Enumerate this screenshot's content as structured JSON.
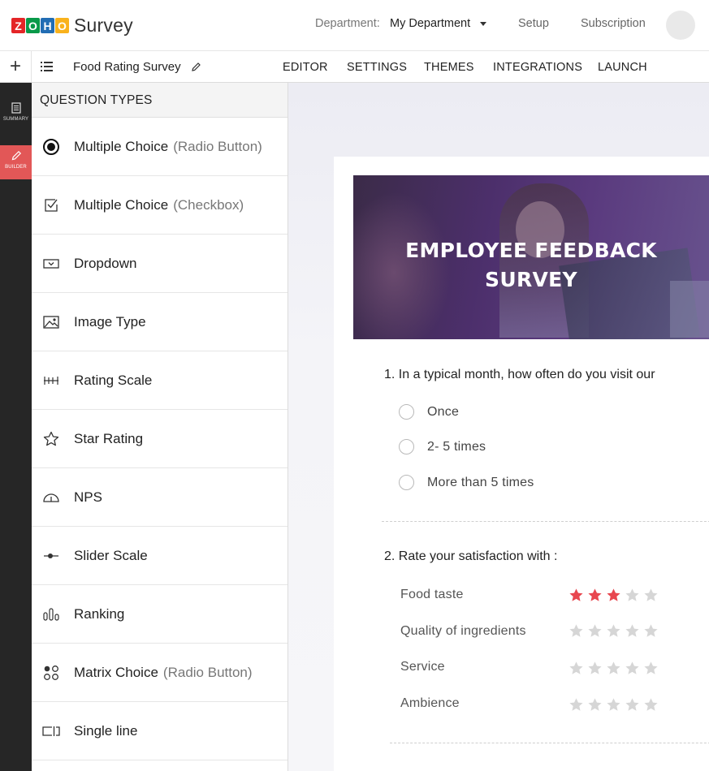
{
  "app": {
    "logo_letters": [
      "Z",
      "O",
      "H",
      "O"
    ],
    "logo_colors": [
      "#e42527",
      "#089949",
      "#226db4",
      "#f9b21d"
    ],
    "product": "Survey"
  },
  "header": {
    "department_label": "Department:",
    "department_value": "My Department",
    "setup": "Setup",
    "subscription": "Subscription"
  },
  "toolbar": {
    "add": "+",
    "survey_name": "Food Rating Survey",
    "tabs": [
      "EDITOR",
      "SETTINGS",
      "THEMES",
      "INTEGRATIONS",
      "LAUNCH"
    ]
  },
  "leftnav": {
    "items": [
      {
        "label": "SUMMARY",
        "icon": "document-icon",
        "active": false
      },
      {
        "label": "BUILDER",
        "icon": "pencil-icon",
        "active": true
      }
    ],
    "active_color": "#e25757"
  },
  "question_types": {
    "title": "QUESTION TYPES",
    "items": [
      {
        "label": "Multiple Choice",
        "sub": "(Radio Button)",
        "icon": "radio-button-icon"
      },
      {
        "label": "Multiple Choice",
        "sub": "(Checkbox)",
        "icon": "checkbox-icon"
      },
      {
        "label": "Dropdown",
        "sub": "",
        "icon": "dropdown-icon"
      },
      {
        "label": "Image Type",
        "sub": "",
        "icon": "image-icon"
      },
      {
        "label": "Rating Scale",
        "sub": "",
        "icon": "rating-scale-icon"
      },
      {
        "label": "Star Rating",
        "sub": "",
        "icon": "star-icon"
      },
      {
        "label": "NPS",
        "sub": "",
        "icon": "gauge-icon"
      },
      {
        "label": "Slider Scale",
        "sub": "",
        "icon": "slider-icon"
      },
      {
        "label": "Ranking",
        "sub": "",
        "icon": "ranking-icon"
      },
      {
        "label": "Matrix Choice",
        "sub": "(Radio Button)",
        "icon": "matrix-icon"
      },
      {
        "label": "Single line",
        "sub": "",
        "icon": "single-line-icon"
      }
    ]
  },
  "survey": {
    "banner_title_line1": "EMPLOYEE FEEDBACK",
    "banner_title_line2": "SURVEY",
    "q1": {
      "text": "1. In a typical month, how often do you visit our",
      "options": [
        "Once",
        "2- 5 times",
        "More than 5 times"
      ]
    },
    "q2": {
      "text": "2. Rate your satisfaction with :",
      "rows": [
        {
          "label": "Food taste",
          "rating": 3
        },
        {
          "label": "Quality of ingredients",
          "rating": 0
        },
        {
          "label": "Service",
          "rating": 0
        },
        {
          "label": "Ambience",
          "rating": 0
        }
      ],
      "max_stars": 5,
      "star_on_color": "#e8474f",
      "star_off_color": "#d6d6d6"
    }
  }
}
